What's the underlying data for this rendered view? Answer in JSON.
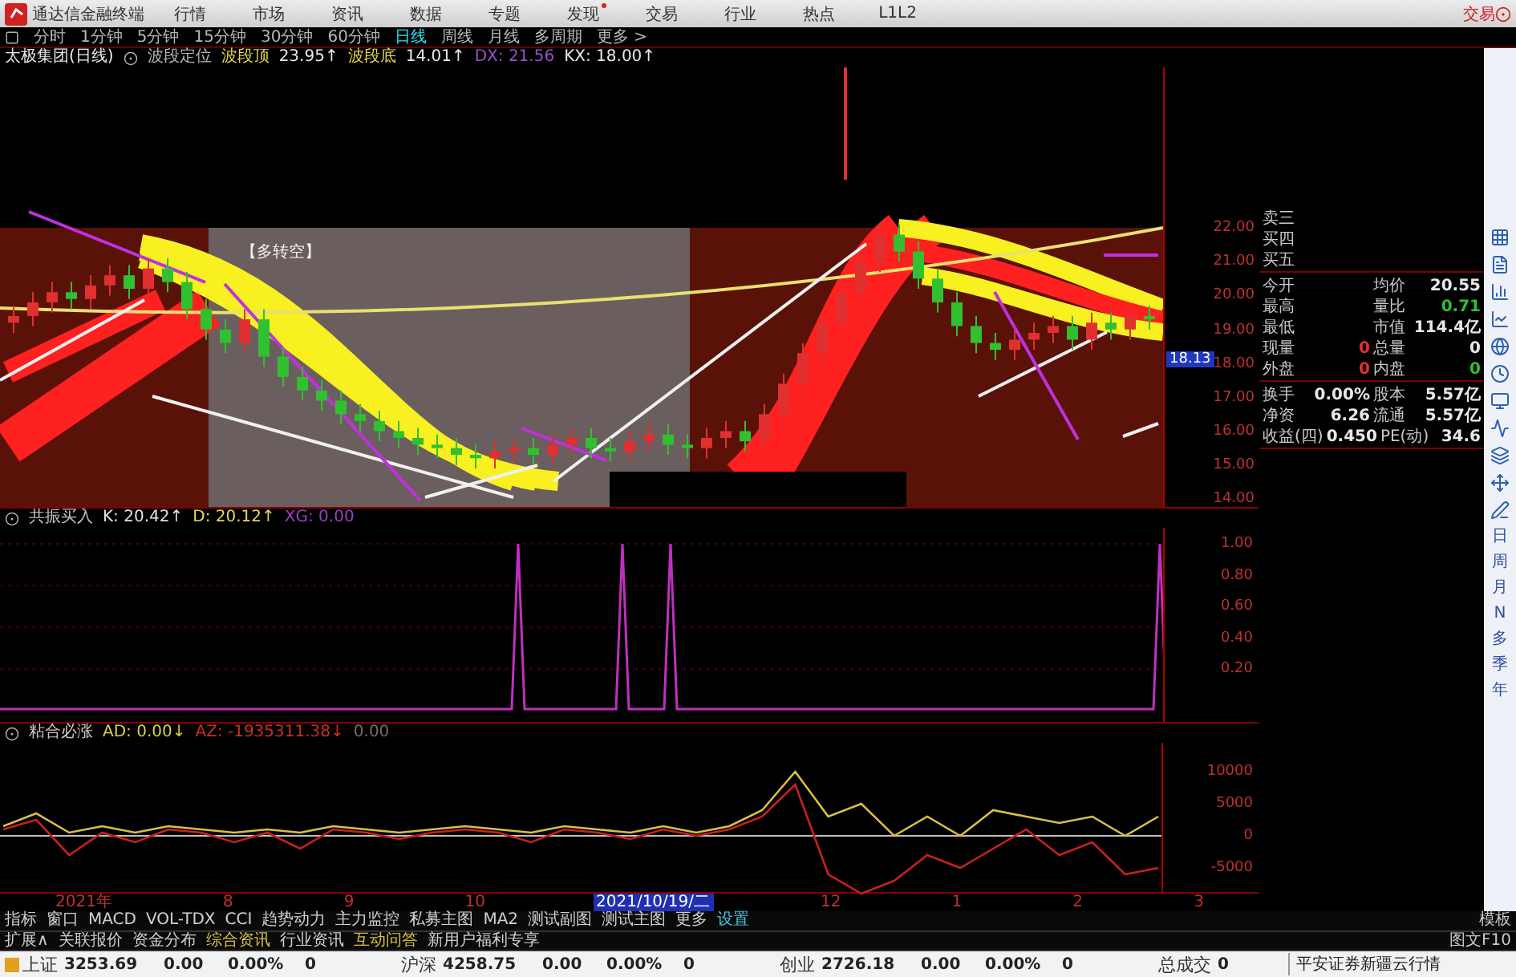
{
  "menu_bar": {
    "app_name": "通达信金融终端",
    "items": [
      {
        "label": "行情",
        "badge": false
      },
      {
        "label": "市场",
        "badge": false
      },
      {
        "label": "资讯",
        "badge": false
      },
      {
        "label": "数据",
        "badge": false
      },
      {
        "label": "专题",
        "badge": false
      },
      {
        "label": "发现",
        "badge": true
      },
      {
        "label": "交易",
        "badge": false
      },
      {
        "label": "行业",
        "badge": false
      },
      {
        "label": "热点",
        "badge": false
      },
      {
        "label": "L1L2",
        "badge": false
      }
    ],
    "trade": "交易"
  },
  "period_bar": {
    "items": [
      {
        "label": "分时",
        "selected": false
      },
      {
        "label": "1分钟",
        "selected": false
      },
      {
        "label": "5分钟",
        "selected": false
      },
      {
        "label": "15分钟",
        "selected": false
      },
      {
        "label": "30分钟",
        "selected": false
      },
      {
        "label": "60分钟",
        "selected": false
      },
      {
        "label": "日线",
        "selected": true
      },
      {
        "label": "周线",
        "selected": false
      },
      {
        "label": "月线",
        "selected": false
      },
      {
        "label": "多周期",
        "selected": false
      },
      {
        "label": "更多 >",
        "selected": false
      }
    ]
  },
  "main_chart": {
    "title": "太极集团(日线)",
    "indicator": "波段定位",
    "legend": [
      {
        "text": "波段顶",
        "color": "#e8d84a"
      },
      {
        "text": "23.95↑",
        "color": "#e8e8e8"
      },
      {
        "text": "波段底",
        "color": "#e8d84a"
      },
      {
        "text": "14.01↑",
        "color": "#e8e8e8"
      },
      {
        "text": "DX: 21.56",
        "color": "#9a4fc8"
      },
      {
        "text": "KX: 18.00↑",
        "color": "#e8e8e8"
      }
    ],
    "annotation": "【多转空】",
    "price_tag": "18.13",
    "chart_data": {
      "type": "candlestick",
      "ylim": [
        14,
        22
      ],
      "yticks": [
        {
          "value": 22,
          "label": "22.00"
        },
        {
          "value": 21,
          "label": "21.00"
        },
        {
          "value": 20,
          "label": "20.00"
        },
        {
          "value": 19,
          "label": "19.00"
        },
        {
          "value": 18,
          "label": "18.00"
        },
        {
          "value": 17,
          "label": "17.00"
        },
        {
          "value": 16,
          "label": "16.00"
        },
        {
          "value": 15,
          "label": "15.00"
        },
        {
          "value": 14,
          "label": "14.00"
        }
      ],
      "ohlc": [
        [
          19.2,
          19.7,
          18.9,
          19.4
        ],
        [
          19.4,
          20.1,
          19.1,
          19.8
        ],
        [
          19.8,
          20.4,
          19.5,
          20.1
        ],
        [
          20.1,
          20.4,
          19.6,
          19.9
        ],
        [
          19.9,
          20.6,
          19.6,
          20.3
        ],
        [
          20.3,
          20.9,
          20.0,
          20.6
        ],
        [
          20.6,
          20.9,
          19.9,
          20.2
        ],
        [
          20.2,
          21.1,
          19.9,
          20.8
        ],
        [
          20.8,
          21.1,
          20.1,
          20.4
        ],
        [
          20.4,
          20.7,
          19.3,
          19.6
        ],
        [
          19.6,
          19.9,
          18.7,
          19.0
        ],
        [
          19.0,
          19.3,
          18.3,
          18.6
        ],
        [
          18.6,
          19.6,
          18.3,
          19.3
        ],
        [
          19.3,
          19.6,
          17.9,
          18.2
        ],
        [
          18.2,
          18.5,
          17.3,
          17.6
        ],
        [
          17.6,
          17.9,
          16.9,
          17.2
        ],
        [
          17.2,
          17.5,
          16.6,
          16.9
        ],
        [
          16.9,
          17.2,
          16.2,
          16.5
        ],
        [
          16.5,
          16.8,
          16.0,
          16.3
        ],
        [
          16.3,
          16.6,
          15.7,
          16.0
        ],
        [
          16.0,
          16.3,
          15.5,
          15.8
        ],
        [
          15.8,
          16.1,
          15.3,
          15.6
        ],
        [
          15.6,
          15.9,
          15.2,
          15.5
        ],
        [
          15.5,
          15.8,
          15.0,
          15.3
        ],
        [
          15.3,
          15.6,
          14.9,
          15.2
        ],
        [
          15.2,
          15.7,
          14.9,
          15.4
        ],
        [
          15.4,
          15.8,
          15.1,
          15.5
        ],
        [
          15.5,
          15.8,
          15.0,
          15.3
        ],
        [
          15.3,
          15.9,
          15.0,
          15.6
        ],
        [
          15.6,
          16.1,
          15.3,
          15.8
        ],
        [
          15.8,
          16.1,
          15.2,
          15.5
        ],
        [
          15.5,
          15.8,
          15.1,
          15.4
        ],
        [
          15.4,
          16.0,
          15.1,
          15.7
        ],
        [
          15.7,
          16.2,
          15.4,
          15.9
        ],
        [
          15.9,
          16.2,
          15.3,
          15.6
        ],
        [
          15.6,
          15.9,
          15.2,
          15.5
        ],
        [
          15.5,
          16.1,
          15.2,
          15.8
        ],
        [
          15.8,
          16.3,
          15.5,
          16.0
        ],
        [
          16.0,
          16.3,
          15.4,
          15.7
        ],
        [
          15.7,
          16.8,
          15.4,
          16.5
        ],
        [
          16.5,
          17.7,
          16.2,
          17.4
        ],
        [
          17.4,
          18.6,
          17.1,
          18.3
        ],
        [
          18.3,
          19.5,
          18.0,
          19.2
        ],
        [
          19.2,
          20.4,
          18.9,
          20.1
        ],
        [
          20.1,
          21.3,
          19.8,
          21.0
        ],
        [
          21.0,
          22.1,
          20.7,
          21.8
        ],
        [
          21.8,
          22.1,
          21.0,
          21.3
        ],
        [
          21.3,
          21.6,
          20.2,
          20.5
        ],
        [
          20.5,
          20.8,
          19.5,
          19.8
        ],
        [
          19.8,
          20.1,
          18.8,
          19.1
        ],
        [
          19.1,
          19.4,
          18.3,
          18.6
        ],
        [
          18.6,
          18.9,
          18.1,
          18.4
        ],
        [
          18.4,
          19.0,
          18.1,
          18.7
        ],
        [
          18.7,
          19.2,
          18.4,
          18.9
        ],
        [
          18.9,
          19.4,
          18.6,
          19.1
        ],
        [
          19.1,
          19.4,
          18.4,
          18.7
        ],
        [
          18.7,
          19.5,
          18.4,
          19.2
        ],
        [
          19.2,
          19.5,
          18.7,
          19.0
        ],
        [
          19.0,
          19.7,
          18.7,
          19.4
        ],
        [
          19.4,
          19.7,
          19.0,
          19.3
        ]
      ]
    }
  },
  "indicator_1": {
    "title": "共振买入",
    "legend": [
      {
        "text": "K: 20.42↑",
        "color": "#e0e0e0"
      },
      {
        "text": "D: 20.12↑",
        "color": "#e8d84a"
      },
      {
        "text": "XG: 0.00",
        "color": "#9a3fc0"
      }
    ],
    "axis": [
      "1.00",
      "0.80",
      "0.60",
      "0.40",
      "0.20"
    ]
  },
  "indicator_2": {
    "title": "粘合必涨",
    "legend": [
      {
        "text": "AD: 0.00↓",
        "color": "#d8d040"
      },
      {
        "text": "AZ: -1935311.38↓",
        "color": "#c83020"
      },
      {
        "text": "0.00",
        "color": "#707070"
      }
    ],
    "chart_data": {
      "type": "line",
      "ylim": [
        -9250,
        14500
      ],
      "yticks": [
        10000,
        5000,
        0,
        -5000
      ],
      "series": [
        {
          "color": "#d8c040",
          "values": [
            1500,
            3500,
            500,
            1500,
            500,
            1500,
            1000,
            500,
            1000,
            500,
            1500,
            1000,
            500,
            1000,
            1500,
            1000,
            500,
            1500,
            1000,
            500,
            1500,
            500,
            1500,
            4000,
            10000,
            3000,
            5000,
            0,
            3000,
            0,
            4000,
            3000,
            2000,
            3000,
            0,
            3000
          ]
        },
        {
          "color": "#c82020",
          "values": [
            1000,
            2500,
            -3000,
            500,
            -1000,
            1000,
            500,
            -1000,
            500,
            -2000,
            1000,
            500,
            -500,
            500,
            1000,
            500,
            -1000,
            1000,
            500,
            -500,
            1000,
            0,
            1000,
            3000,
            8000,
            -6000,
            -9000,
            -7000,
            -3000,
            -5000,
            -2000,
            1000,
            -3000,
            -1000,
            -6000,
            -5000
          ]
        }
      ]
    }
  },
  "date_axis": [
    {
      "label": "2021年",
      "selected": false
    },
    {
      "label": "8",
      "selected": false
    },
    {
      "label": "9",
      "selected": false
    },
    {
      "label": "10",
      "selected": false
    },
    {
      "label": "2021/10/19/二",
      "selected": true
    },
    {
      "label": "12",
      "selected": false
    },
    {
      "label": "1",
      "selected": false
    },
    {
      "label": "2",
      "selected": false
    },
    {
      "label": "3",
      "selected": false
    }
  ],
  "quote_panel": [
    {
      "rows": [
        {
          "left": {
            "label": "卖三"
          }
        },
        {
          "left": {
            "label": "买四"
          }
        },
        {
          "left": {
            "label": "买五"
          }
        }
      ]
    },
    {
      "rows": [
        {
          "left": {
            "label": "今开"
          },
          "right": {
            "label": "均价",
            "value": "20.55",
            "color": "#e8e8e8"
          }
        },
        {
          "left": {
            "label": "最高"
          },
          "right": {
            "label": "量比",
            "value": "0.71",
            "color": "#30c030"
          }
        },
        {
          "left": {
            "label": "最低"
          },
          "right": {
            "label": "市值",
            "value": "114.4亿",
            "color": "#e8e8e8"
          }
        },
        {
          "left": {
            "label": "现量",
            "value": "0",
            "color": "#e03030"
          },
          "right": {
            "label": "总量",
            "value": "0",
            "color": "#e8e8e8"
          }
        },
        {
          "left": {
            "label": "外盘",
            "value": "0",
            "color": "#e03030"
          },
          "right": {
            "label": "内盘",
            "value": "0",
            "color": "#30c030"
          }
        }
      ]
    },
    {
      "rows": [
        {
          "left": {
            "label": "换手",
            "value": "0.00%",
            "color": "#e8e8e8"
          },
          "right": {
            "label": "股本",
            "value": "5.57亿",
            "color": "#e8e8e8"
          }
        },
        {
          "left": {
            "label": "净资",
            "value": "6.26",
            "color": "#e8e8e8"
          },
          "right": {
            "label": "流通",
            "value": "5.57亿",
            "color": "#e8e8e8"
          }
        },
        {
          "left": {
            "label": "收益(四)",
            "value": "0.450",
            "color": "#e8e8e8"
          },
          "right": {
            "label": "PE(动)",
            "value": "34.6",
            "color": "#e8e8e8"
          }
        }
      ]
    }
  ],
  "side_periods": [
    "日",
    "周",
    "月",
    "N",
    "多",
    "季",
    "年"
  ],
  "tab_rows": [
    {
      "items": [
        {
          "label": "指标",
          "kind": "plain"
        },
        {
          "label": "窗口",
          "kind": "plain"
        },
        {
          "label": "MACD",
          "kind": "plain"
        },
        {
          "label": "VOL-TDX",
          "kind": "plain"
        },
        {
          "label": "CCI",
          "kind": "plain"
        },
        {
          "label": "趋势动力",
          "kind": "plain"
        },
        {
          "label": "主力监控",
          "kind": "plain"
        },
        {
          "label": "私募主图",
          "kind": "plain"
        },
        {
          "label": "MA2",
          "kind": "plain"
        },
        {
          "label": "测试副图",
          "kind": "plain"
        },
        {
          "label": "测试主图",
          "kind": "plain"
        },
        {
          "label": "更多",
          "kind": "plain"
        },
        {
          "label": "设置",
          "kind": "accent"
        }
      ],
      "right": "模板"
    },
    {
      "items": [
        {
          "label": "扩展∧",
          "kind": "plain"
        },
        {
          "label": "关联报价",
          "kind": "plain"
        },
        {
          "label": "资金分布",
          "kind": "plain"
        },
        {
          "label": "综合资讯",
          "kind": "featured"
        },
        {
          "label": "行业资讯",
          "kind": "plain"
        },
        {
          "label": "互动问答",
          "kind": "featured"
        },
        {
          "label": "新用户福利专享",
          "kind": "plain"
        }
      ],
      "right": "图文F10"
    }
  ],
  "status_bar": {
    "indices": [
      {
        "name": "上证",
        "values": [
          "3253.69",
          "0.00",
          "0.00%",
          "0"
        ]
      },
      {
        "name": "沪深",
        "values": [
          "4258.75",
          "0.00",
          "0.00%",
          "0"
        ]
      },
      {
        "name": "创业",
        "values": [
          "2726.18",
          "0.00",
          "0.00%",
          "0"
        ]
      }
    ],
    "total": {
      "label": "总成交",
      "value": "0"
    },
    "news": "平安证券新疆云行情"
  }
}
